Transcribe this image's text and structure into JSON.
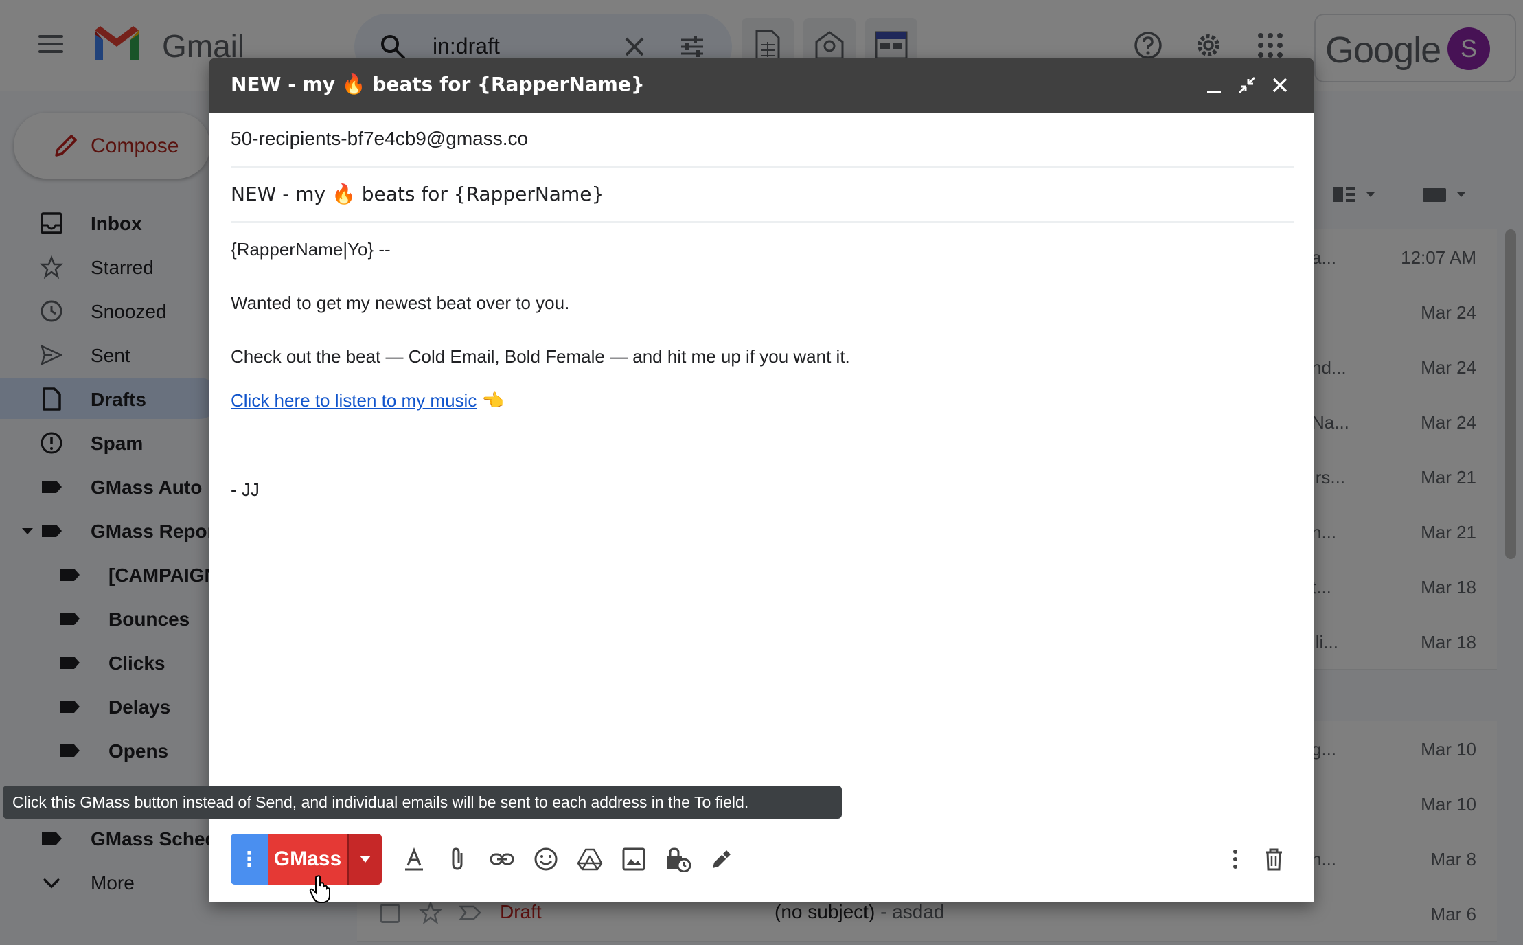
{
  "app": {
    "name": "Gmail",
    "google_word": "Google",
    "avatar_initial": "S"
  },
  "search": {
    "value": "in:draft"
  },
  "sidebar": {
    "compose_label": "Compose",
    "items": [
      {
        "label": "Inbox"
      },
      {
        "label": "Starred"
      },
      {
        "label": "Snoozed"
      },
      {
        "label": "Sent"
      },
      {
        "label": "Drafts"
      },
      {
        "label": "Spam"
      },
      {
        "label": "GMass Auto F"
      },
      {
        "label": "GMass Repor"
      },
      {
        "label": "[CAMPAIGN"
      },
      {
        "label": "Bounces"
      },
      {
        "label": "Clicks"
      },
      {
        "label": "Delays"
      },
      {
        "label": "Opens"
      },
      {
        "label": "GMass Sched"
      },
      {
        "label": "More"
      }
    ]
  },
  "mail_list": {
    "rows": [
      {
        "snippet": "a...",
        "date": "12:07 AM"
      },
      {
        "snippet": "",
        "date": "Mar 24"
      },
      {
        "snippet": "nd...",
        "date": "Mar 24"
      },
      {
        "snippet": "Na...",
        "date": "Mar 24"
      },
      {
        "snippet": "irs...",
        "date": "Mar 21"
      },
      {
        "snippet": "n...",
        "date": "Mar 21"
      },
      {
        "snippet": "t...",
        "date": "Mar 18"
      },
      {
        "snippet": "ili...",
        "date": "Mar 18"
      },
      {
        "snippet": "g...",
        "date": "Mar 10"
      },
      {
        "snippet": "",
        "date": "Mar 10"
      },
      {
        "snippet": "h...",
        "date": "Mar 8"
      }
    ],
    "last_row": {
      "label": "Draft",
      "subject": "(no subject)",
      "snippet": " - asdad",
      "date": "Mar 6"
    }
  },
  "compose": {
    "title": "NEW - my 🔥 beats for {RapperName}",
    "to": "50-recipients-bf7e4cb9@gmass.co",
    "subject": "NEW - my 🔥 beats for {RapperName}",
    "body": {
      "greeting": "{RapperName|Yo} --",
      "line1": "Wanted to get my newest beat over to you.",
      "line2": "Check out the beat — Cold Email, Bold Female — and hit me up if you want it.",
      "link_text": "Click here to listen to my music",
      "link_emoji": "👈",
      "signature": "- JJ"
    },
    "toolbar": {
      "options_label": "⋮",
      "gmass_label": "GMass"
    }
  },
  "tooltip": {
    "text": "Click this GMass button instead of Send, and individual emails will be sent to each address in the To field."
  },
  "colors": {
    "gmass_red": "#e53935",
    "gmass_dark_red": "#c62828",
    "options_blue": "#4a8ff0",
    "compose_bar": "#404040",
    "link_blue": "#1155cc",
    "avatar_purple": "#8e24aa"
  }
}
